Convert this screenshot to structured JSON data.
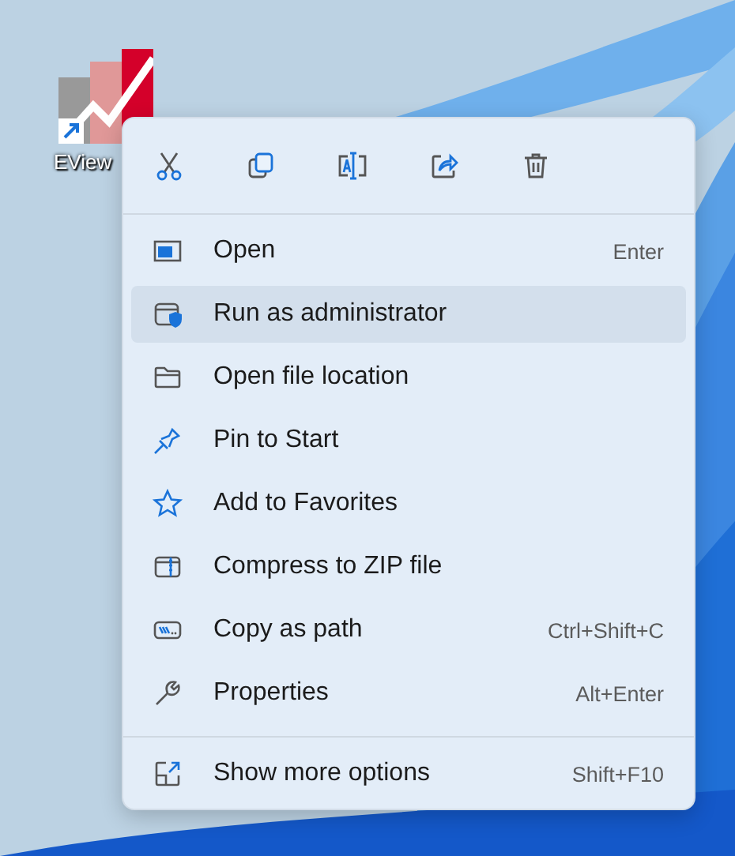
{
  "desktop_icon": {
    "label": "EView"
  },
  "context_menu": {
    "toolbar": [
      {
        "kind": "cut"
      },
      {
        "kind": "copy"
      },
      {
        "kind": "rename"
      },
      {
        "kind": "share"
      },
      {
        "kind": "delete"
      }
    ],
    "items": [
      {
        "label": "Open",
        "shortcut": "Enter",
        "selected": false
      },
      {
        "label": "Run as administrator",
        "selected": true
      },
      {
        "label": "Open file location",
        "selected": false
      },
      {
        "label": "Pin to Start",
        "selected": false
      },
      {
        "label": "Add to Favorites",
        "selected": false
      },
      {
        "label": "Compress to ZIP file",
        "selected": false
      },
      {
        "label": "Copy as path",
        "shortcut": "Ctrl+Shift+C",
        "selected": false
      },
      {
        "label": "Properties",
        "shortcut": "Alt+Enter",
        "selected": false
      }
    ],
    "footer": {
      "label": "Show more options",
      "shortcut": "Shift+F10"
    }
  }
}
